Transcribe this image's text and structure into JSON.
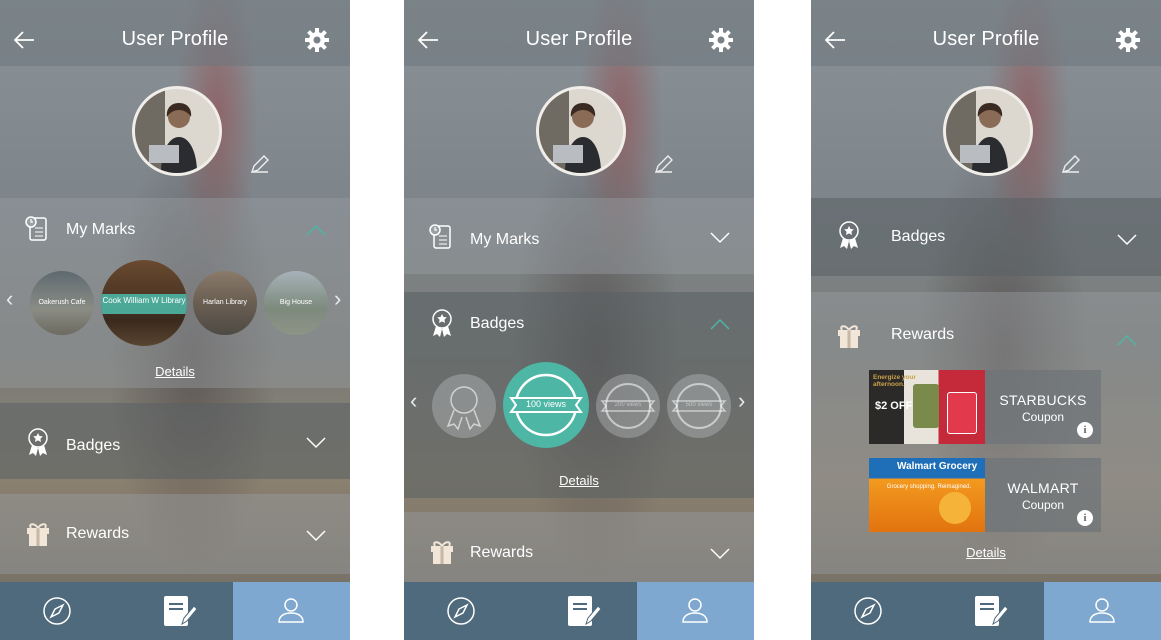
{
  "screens": [
    {
      "title": "User Profile",
      "marks": {
        "label": "My Marks",
        "items": [
          "Oakerush Cafe",
          "Cook William W Library",
          "Harlan Library",
          "Big House"
        ],
        "details": "Details"
      },
      "badges_label": "Badges",
      "rewards_label": "Rewards"
    },
    {
      "title": "User Profile",
      "marks_label": "My Marks",
      "badges": {
        "label": "Badges",
        "items": [
          "",
          "100 views",
          "200 views",
          "500 views"
        ],
        "details": "Details"
      },
      "rewards_label": "Rewards"
    },
    {
      "title": "User Profile",
      "badges_label": "Badges",
      "rewards": {
        "label": "Rewards",
        "coupons": [
          {
            "brand": "STARBUCKS",
            "type": "Coupon",
            "info": "i",
            "ad_text": "Energize your afternoon.",
            "ad_price": "$2 OFF"
          },
          {
            "brand": "WALMART",
            "type": "Coupon",
            "info": "i",
            "ad_text": "Walmart Grocery",
            "ad_sub": "Grocery shopping. Reimagined."
          }
        ],
        "details": "Details"
      }
    }
  ],
  "colors": {
    "accent": "#4db6a4",
    "nav_active": "#7ea8cf",
    "nav_bg": "#4f6a7c"
  },
  "icons": {
    "back": "back-arrow-icon",
    "settings": "gear-icon",
    "edit": "pencil-icon",
    "explore": "compass-icon",
    "marks": "notebook-icon",
    "profile": "user-icon"
  }
}
